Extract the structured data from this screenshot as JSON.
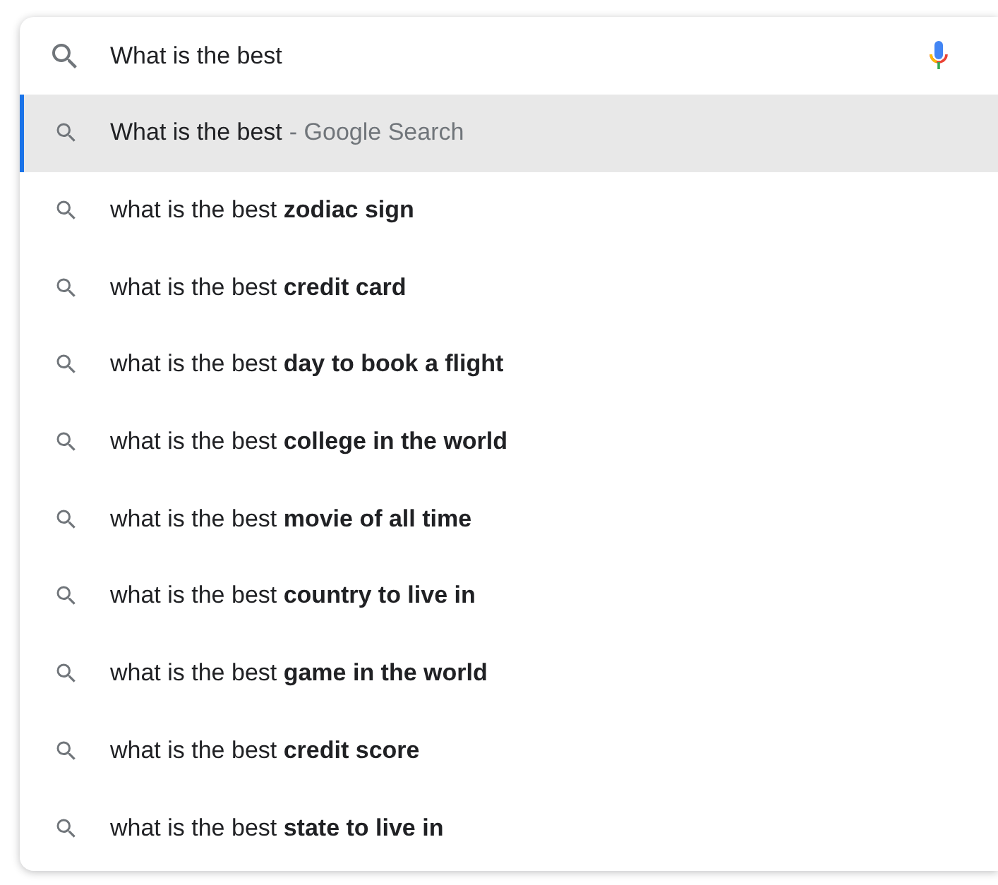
{
  "search": {
    "value": "What is the best"
  },
  "suggestions": [
    {
      "text": "What is the best",
      "suffix": "- Google Search",
      "selected": true
    },
    {
      "text": "what is the best **zodiac sign**",
      "selected": false
    },
    {
      "text": "what is the best **credit card**",
      "selected": false
    },
    {
      "text": "what is the best **day to book a flight**",
      "selected": false
    },
    {
      "text": "what is the best **college in the world**",
      "selected": false
    },
    {
      "text": "what is the best **movie of all time**",
      "selected": false
    },
    {
      "text": "what is the best **country to live in**",
      "selected": false
    },
    {
      "text": "what is the best **game in the world**",
      "selected": false
    },
    {
      "text": "what is the best **credit score**",
      "selected": false
    },
    {
      "text": "what is the best **state to live in**",
      "selected": false
    }
  ]
}
